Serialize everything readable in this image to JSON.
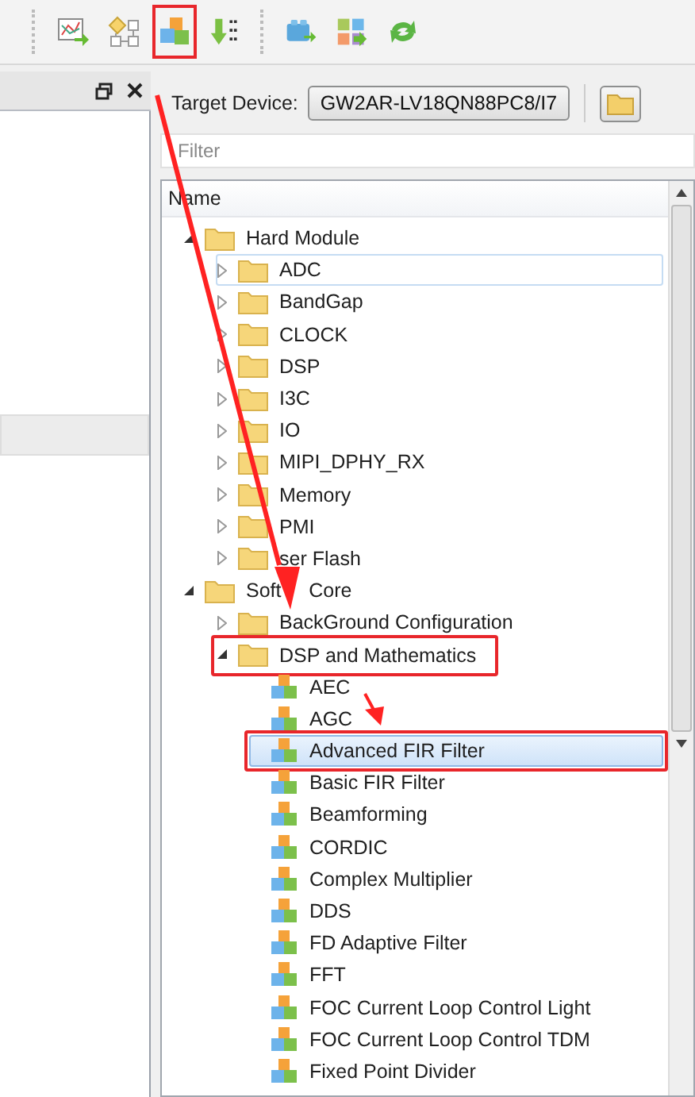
{
  "toolbar": {
    "icons": [
      {
        "kind": "chart",
        "annotated": false
      },
      {
        "kind": "flow",
        "annotated": false
      },
      {
        "kind": "cubes",
        "annotated": true
      },
      {
        "kind": "download",
        "annotated": false
      },
      {
        "kind": "block",
        "annotated": false
      },
      {
        "kind": "tiles",
        "annotated": false
      },
      {
        "kind": "refresh",
        "annotated": false
      }
    ]
  },
  "target_device": {
    "label": "Target Device:",
    "value": "GW2AR-LV18QN88PC8/I7"
  },
  "filter": {
    "placeholder": "Filter"
  },
  "tree": {
    "column": "Name",
    "items": [
      {
        "label": "Hard Module",
        "kind": "folder",
        "expanded": true,
        "children": [
          {
            "label": "ADC",
            "kind": "folder",
            "expanded": false,
            "hovered": true
          },
          {
            "label": "BandGap",
            "kind": "folder",
            "expanded": false
          },
          {
            "label": "CLOCK",
            "kind": "folder",
            "expanded": false
          },
          {
            "label": "DSP",
            "kind": "folder",
            "expanded": false
          },
          {
            "label": "I3C",
            "kind": "folder",
            "expanded": false
          },
          {
            "label": "IO",
            "kind": "folder",
            "expanded": false
          },
          {
            "label": "MIPI_DPHY_RX",
            "kind": "folder",
            "expanded": false
          },
          {
            "label": "Memory",
            "kind": "folder",
            "expanded": false
          },
          {
            "label": "PMI",
            "kind": "folder",
            "expanded": false
          },
          {
            "label": "ser Flash",
            "kind": "folder",
            "expanded": false
          }
        ]
      },
      {
        "label": "Soft     Core",
        "kind": "folder",
        "expanded": true,
        "children": [
          {
            "label": "BackGround Configuration",
            "kind": "folder",
            "expanded": false
          },
          {
            "label": "DSP and Mathematics",
            "kind": "folder",
            "expanded": true,
            "annotated": true,
            "children": [
              {
                "label": "AEC",
                "kind": "ip"
              },
              {
                "label": "AGC",
                "kind": "ip"
              },
              {
                "label": "Advanced FIR Filter",
                "kind": "ip",
                "selected": true,
                "annotated": true
              },
              {
                "label": "Basic FIR Filter",
                "kind": "ip"
              },
              {
                "label": "Beamforming",
                "kind": "ip"
              },
              {
                "label": "CORDIC",
                "kind": "ip"
              },
              {
                "label": "Complex Multiplier",
                "kind": "ip"
              },
              {
                "label": "DDS",
                "kind": "ip"
              },
              {
                "label": "FD Adaptive Filter",
                "kind": "ip"
              },
              {
                "label": "FFT",
                "kind": "ip"
              },
              {
                "label": "FOC Current Loop Control Light",
                "kind": "ip"
              },
              {
                "label": "FOC Current Loop Control TDM",
                "kind": "ip"
              },
              {
                "label": "Fixed Point Divider",
                "kind": "ip"
              }
            ]
          }
        ]
      }
    ]
  }
}
